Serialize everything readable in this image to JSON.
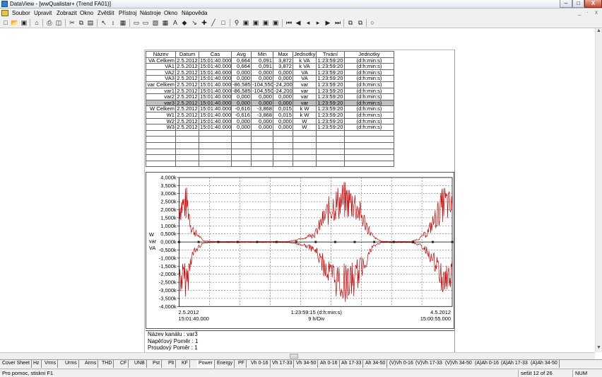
{
  "window": {
    "title": "DataView - [wwQualistar+ (Trend FA01)]",
    "minimize": "–",
    "maximize": "□",
    "close": "X"
  },
  "menu": [
    "Soubor",
    "Upravit",
    "Zobrazit",
    "Okno",
    "Zvětšit",
    "Přístroj",
    "Nástroje",
    "Okno",
    "Nápověda"
  ],
  "mdi_controls": [
    "_",
    "·",
    "x"
  ],
  "toolbar_icons": [
    "new-icon",
    "open-icon",
    "save-icon",
    "home-icon",
    "print-icon",
    "print-preview-icon",
    "cut-icon",
    "copy-icon",
    "paste-icon",
    "pointer-icon",
    "select-icon",
    "chart-icon",
    "table-icon",
    "text-icon",
    "line-icon",
    "rect-icon",
    "zoom-icon",
    "first-icon",
    "prev-page-icon",
    "prev-icon",
    "next-icon",
    "next-page-icon",
    "last-icon",
    "window-icon",
    "record-icon"
  ],
  "table": {
    "headers": [
      "Název",
      "Datum",
      "Čas",
      "Avg",
      "Min",
      "Max",
      "Jednotky",
      "Trvání",
      "Jednotky"
    ],
    "rows": [
      [
        "VA Celkem",
        "2.5.2012",
        "15:01:40.000",
        "0,664",
        "0,091",
        "3,872",
        "k VA",
        "1:23:59:20",
        "(d:h:min:s)"
      ],
      [
        "VA1",
        "2.5.2012",
        "15:01:40.000",
        "0,664",
        "0,091",
        "3,872",
        "k VA",
        "1:23:59:20",
        "(d:h:min:s)"
      ],
      [
        "VA2",
        "2.5.2012",
        "15:01:40.000",
        "0,000",
        "0,000",
        "0,000",
        "VA",
        "1:23:59:20",
        "(d:h:min:s)"
      ],
      [
        "VA3",
        "2.5.2012",
        "15:01:40.000",
        "0,000",
        "0,000",
        "0,000",
        "VA",
        "1:23:59:20",
        "(d:h:min:s)"
      ],
      [
        "var Celkem",
        "2.5.2012",
        "15:01:40.000",
        "-86,585",
        "-104,550",
        "-24,200",
        "var",
        "1:23:59:20",
        "(d:h:min:s)"
      ],
      [
        "var1",
        "2.5.2012",
        "15:01:40.000",
        "-86,585",
        "-104,550",
        "-24,200",
        "var",
        "1:23:59:20",
        "(d:h:min:s)"
      ],
      [
        "var2",
        "2.5.2012",
        "15:01:40.000",
        "0,000",
        "0,000",
        "0,000",
        "var",
        "1:23:59:20",
        "(d:h:min:s)"
      ],
      [
        "var3",
        "2.5.2012",
        "15:01:40.000",
        "0,000",
        "0,000",
        "0,000",
        "var",
        "1:23:59:20",
        "(d:h:min:s)"
      ],
      [
        "W Celkem",
        "2.5.2012",
        "15:01:40.000",
        "-0,616",
        "-3,868",
        "0,015",
        "k W",
        "1:23:59:20",
        "(d:h:min:s)"
      ],
      [
        "W1",
        "2.5.2012",
        "15:01:40.000",
        "-0,616",
        "-3,868",
        "0,015",
        "k W",
        "1:23:59:20",
        "(d:h:min:s)"
      ],
      [
        "W2",
        "2.5.2012",
        "15:01:40.000",
        "0,000",
        "0,000",
        "0,000",
        "W",
        "1:23:59:20",
        "(d:h:min:s)"
      ],
      [
        "W3",
        "2.5.2012",
        "15:01:40.000",
        "0,000",
        "0,000",
        "0,000",
        "W",
        "1:23:59:20",
        "(d:h:min:s)"
      ]
    ],
    "selected_row": 7,
    "empty_rows": 6
  },
  "chart_data": {
    "type": "line",
    "title": "",
    "y_tick_labels": [
      "4,000k",
      "3,500k",
      "3,000k",
      "2,500k",
      "2,000k",
      "1,500k",
      "1,000k",
      "0,500k",
      "0,000k",
      "-0,500k",
      "-1,000k",
      "-1,500k",
      "-2,000k",
      "-2,500k",
      "-3,000k",
      "-3,500k",
      "-4,000k"
    ],
    "ylim": [
      -4000,
      4000
    ],
    "y_unit_labels": [
      "W",
      "var",
      "VA"
    ],
    "x_labels": {
      "left_date": "2.5.2012",
      "left_time": "15:01:40.000",
      "center_span": "1:23:59:15 (d:h:min:s)",
      "center_div": "9 h/Div",
      "right_date": "4.5.2012",
      "right_time": "15:00:55.000"
    },
    "grid": true,
    "series_color": "#cc0000",
    "envelope": [
      [
        0.0,
        3300
      ],
      [
        0.03,
        3500
      ],
      [
        0.045,
        1300
      ],
      [
        0.07,
        500
      ],
      [
        0.09,
        80
      ],
      [
        0.13,
        40
      ],
      [
        0.25,
        30
      ],
      [
        0.4,
        40
      ],
      [
        0.46,
        300
      ],
      [
        0.5,
        800
      ],
      [
        0.53,
        2200
      ],
      [
        0.56,
        3300
      ],
      [
        0.6,
        3800
      ],
      [
        0.64,
        3600
      ],
      [
        0.68,
        1800
      ],
      [
        0.71,
        400
      ],
      [
        0.74,
        50
      ],
      [
        0.85,
        40
      ],
      [
        0.88,
        250
      ],
      [
        0.91,
        900
      ],
      [
        0.94,
        2200
      ],
      [
        0.97,
        3700
      ],
      [
        1.0,
        3000
      ]
    ]
  },
  "info": {
    "channel": "Název kanálu : var3",
    "voltage_ratio": "Napěťový Poměr : 1",
    "current_ratio": "Proudový Poměr : 1"
  },
  "tabs": [
    "Cover Sheet",
    "Hz",
    "Vrms",
    "Urms",
    "Arms",
    "THD",
    "CF",
    "UNB",
    "Pst",
    "Plt",
    "KF",
    "Power",
    "Energy",
    "PF",
    "Vh 0-16",
    "Vh 17-33",
    "Vh 34-50",
    "Ah 0-16",
    "Ah 17-33",
    "Ah 34-50",
    "(V)Vh 0-16",
    "(V)Vh 17-33",
    "(V)Vh 34-50",
    "(A)Ah 0-16",
    "(A)Ah 17-33",
    "(A)Ah 34-50"
  ],
  "active_tab": 11,
  "status": {
    "help": "Pro pomoc, stiskni F1",
    "sheet": "sešit 12 of 26",
    "num": "NUM"
  }
}
